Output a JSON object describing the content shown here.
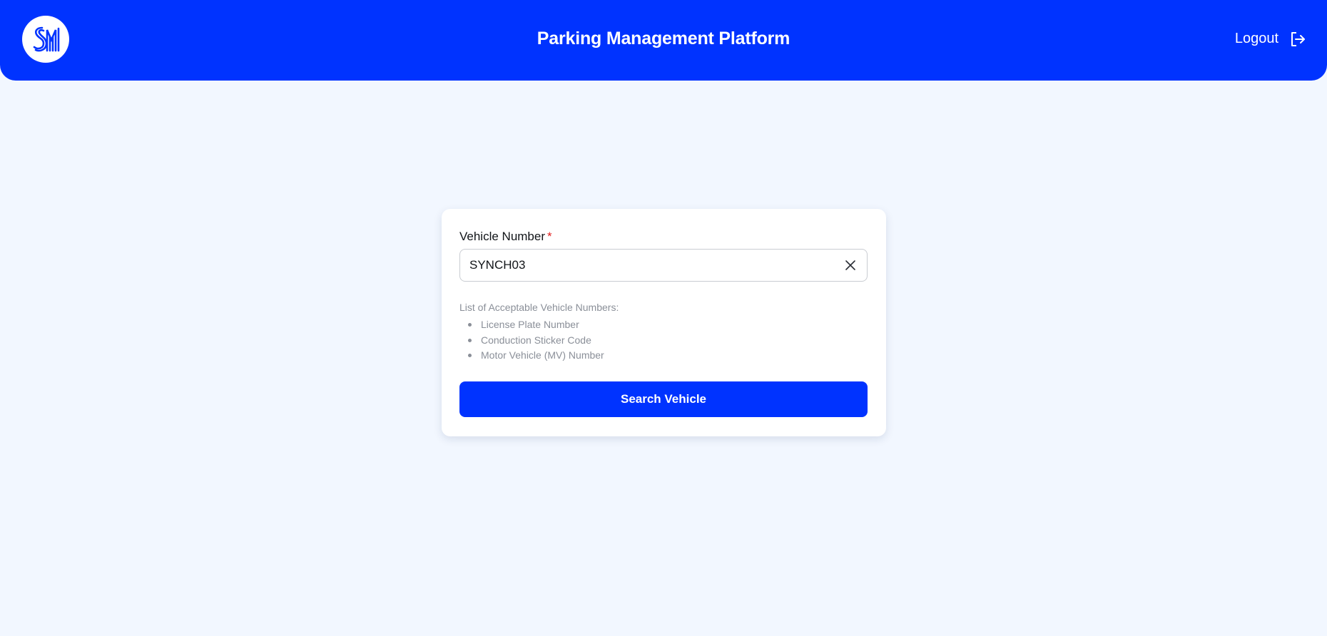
{
  "header": {
    "logo_text": "SM",
    "title": "Parking Management Platform",
    "logout_label": "Logout",
    "logout_icon": "logout-icon",
    "brand_color": "#0033ff"
  },
  "form": {
    "field_label": "Vehicle Number",
    "required_marker": "*",
    "vehicle_number_value": "SYNCH03",
    "clear_icon": "close-icon",
    "hint_title": "List of Acceptable Vehicle Numbers:",
    "hint_items": [
      "License Plate Number",
      "Conduction Sticker Code",
      "Motor Vehicle (MV) Number"
    ],
    "search_button_label": "Search Vehicle"
  }
}
